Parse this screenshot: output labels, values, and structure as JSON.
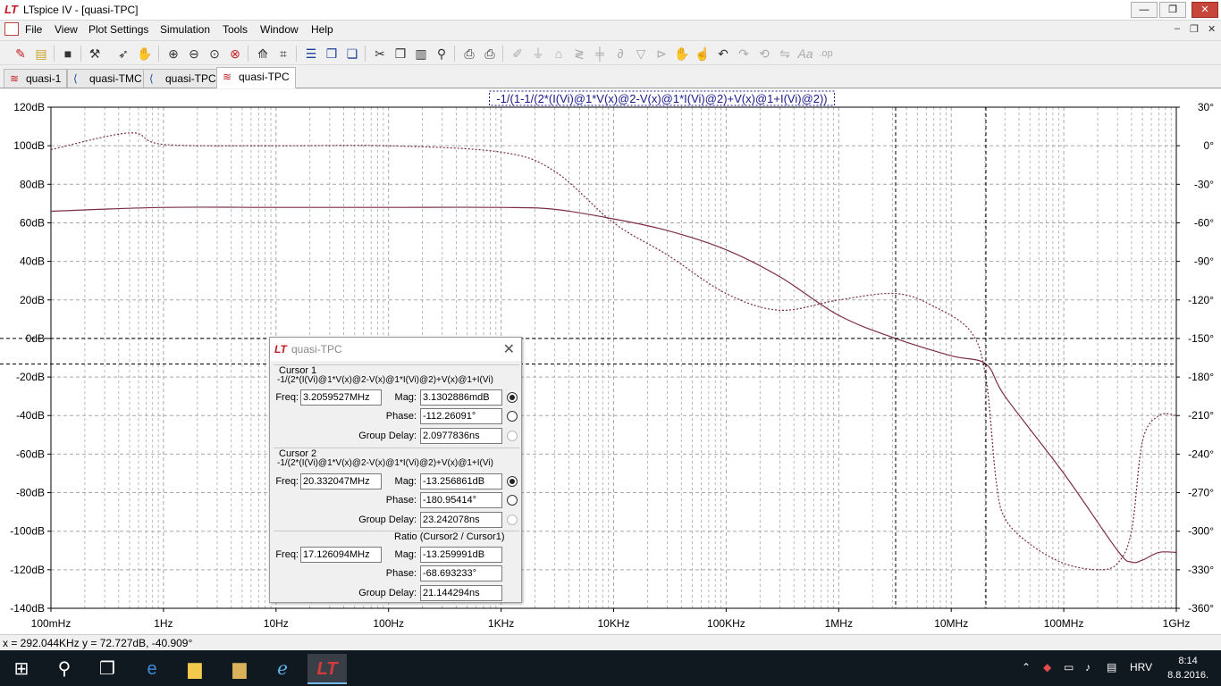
{
  "window": {
    "title": "LTspice IV - [quasi-TPC]",
    "minimize": "—",
    "restore": "❐",
    "close": "✕"
  },
  "menu": {
    "items": [
      "File",
      "View",
      "Plot Settings",
      "Simulation",
      "Tools",
      "Window",
      "Help"
    ],
    "mdi": [
      "–",
      "❐",
      "✕"
    ]
  },
  "toolbar": {
    "icons": [
      "new-schematic-icon",
      "open-icon",
      "save-icon",
      "control-panel-icon",
      "run-icon",
      "halt-icon",
      "zoom-in-icon",
      "zoom-out-icon",
      "zoom-full-icon",
      "zoom-cancel-icon",
      "autorange-icon",
      "grid-icon",
      "tile-horizontal-icon",
      "cascade-icon",
      "tile-vertical-icon",
      "cut-icon",
      "copy-icon",
      "paste-icon",
      "find-icon",
      "print-setup-icon",
      "print-icon",
      "wire-icon",
      "ground-icon",
      "label-icon",
      "resistor-icon",
      "capacitor-icon",
      "inductor-icon",
      "diode-icon",
      "component-icon",
      "move-icon",
      "drag-icon",
      "undo-icon",
      "redo-icon",
      "rotate-icon",
      "mirror-icon",
      "text-icon",
      "spice-directive-icon"
    ]
  },
  "tabs": [
    {
      "label": "quasi-1",
      "icon": "waveform-icon"
    },
    {
      "label": "quasi-TMC",
      "icon": "schematic-icon"
    },
    {
      "label": "quasi-TPC",
      "icon": "schematic-icon"
    },
    {
      "label": "quasi-TPC",
      "icon": "waveform-icon",
      "active": true
    }
  ],
  "plot": {
    "trace_label": "-1/(1-1/(2*(I(Vi)@1*V(x)@2-V(x)@1*I(Vi)@2)+V(x)@1+I(Vi)@2))",
    "trace_color": "#7b2c4a",
    "grid_color": "#a8a8a8",
    "cursor_color": "#000000"
  },
  "chart_data": {
    "type": "line",
    "title": "-1/(1-1/(2*(I(Vi)@1*V(x)@2-V(x)@1*I(Vi)@2)+V(x)@1+I(Vi)@2))",
    "xscale": "log",
    "xlim": [
      0.1,
      1000000000
    ],
    "x_tick_labels": [
      "100mHz",
      "1Hz",
      "10Hz",
      "100Hz",
      "1KHz",
      "10KHz",
      "100KHz",
      "1MHz",
      "10MHz",
      "100MHz",
      "1GHz"
    ],
    "x_tick_values": [
      0.1,
      1,
      10,
      100,
      1000,
      10000,
      100000,
      1000000,
      10000000,
      100000000,
      1000000000
    ],
    "ylim_left": [
      -140,
      120
    ],
    "y_left_ticks": [
      "120dB",
      "100dB",
      "80dB",
      "60dB",
      "40dB",
      "20dB",
      "0dB",
      "-20dB",
      "-40dB",
      "-60dB",
      "-80dB",
      "-100dB",
      "-120dB",
      "-140dB"
    ],
    "y_left_values": [
      120,
      100,
      80,
      60,
      40,
      20,
      0,
      -20,
      -40,
      -60,
      -80,
      -100,
      -120,
      -140
    ],
    "ylim_right": [
      -360,
      30
    ],
    "y_right_ticks": [
      "30°",
      "0°",
      "-30°",
      "-60°",
      "-90°",
      "-120°",
      "-150°",
      "-180°",
      "-210°",
      "-240°",
      "-270°",
      "-300°",
      "-330°",
      "-360°"
    ],
    "y_right_values": [
      30,
      0,
      -30,
      -60,
      -90,
      -120,
      -150,
      -180,
      -210,
      -240,
      -270,
      -300,
      -330,
      -360
    ],
    "grid": true,
    "series": [
      {
        "kind": "magnitude",
        "axis": "left",
        "style": "solid",
        "x": [
          0.1,
          1,
          10,
          100,
          1000,
          3000,
          10000,
          30000,
          100000,
          300000,
          1000000,
          3205953,
          10000000,
          20332047,
          30000000,
          100000000,
          300000000,
          400000000,
          500000000,
          700000000,
          1000000000
        ],
        "y": [
          66,
          68,
          68,
          68,
          68,
          67,
          62,
          56,
          46,
          32,
          12,
          0.003,
          -9,
          -13.26,
          -30,
          -70,
          -110,
          -116,
          -115,
          -111,
          -111
        ]
      },
      {
        "kind": "phase",
        "axis": "right",
        "style": "dashed",
        "x": [
          0.1,
          0.5,
          1,
          10,
          100,
          1000,
          3000,
          10000,
          30000,
          100000,
          300000,
          1000000,
          3205953,
          7000000,
          15000000,
          20332047,
          25000000,
          30000000,
          50000000,
          100000000,
          200000000,
          300000000,
          400000000,
          500000000,
          700000000,
          1000000000
        ],
        "y": [
          -3,
          10,
          1,
          0,
          0,
          -5,
          -20,
          -60,
          -85,
          -115,
          -128,
          -120,
          -115,
          -125,
          -145,
          -180.95,
          -260,
          -290,
          -310,
          -325,
          -330,
          -325,
          -300,
          -230,
          -210,
          -210
        ]
      }
    ],
    "cursors": [
      {
        "name": "Cursor 1",
        "freq_hz": 3205952.7,
        "mag_db": 0.0031302886,
        "phase_deg": -112.26091
      },
      {
        "name": "Cursor 2",
        "freq_hz": 20332047,
        "mag_db": -13.256861,
        "phase_deg": -180.95414
      }
    ]
  },
  "status": {
    "readout": "x = 292.044KHz   y = 72.727dB, -40.909°"
  },
  "cursor_dialog": {
    "title": "quasi-TPC",
    "close": "✕",
    "cursor1": {
      "label": "Cursor 1",
      "expr": "-1/(2*(I(Vi)@1*V(x)@2-V(x)@1*I(Vi)@2)+V(x)@1+I(Vi)",
      "freq_label": "Freq:",
      "freq": "3.2059527MHz",
      "mag_label": "Mag:",
      "mag": "3.1302886mdB",
      "phase_label": "Phase:",
      "phase": "-112.26091°",
      "gd_label": "Group Delay:",
      "gd": "2.0977836ns"
    },
    "cursor2": {
      "label": "Cursor 2",
      "expr": "-1/(2*(I(Vi)@1*V(x)@2-V(x)@1*I(Vi)@2)+V(x)@1+I(Vi)",
      "freq_label": "Freq:",
      "freq": "20.332047MHz",
      "mag_label": "Mag:",
      "mag": "-13.256861dB",
      "phase_label": "Phase:",
      "phase": "-180.95414°",
      "gd_label": "Group Delay:",
      "gd": "23.242078ns"
    },
    "ratio": {
      "label": "Ratio (Cursor2 / Cursor1)",
      "freq_label": "Freq:",
      "freq": "17.126094MHz",
      "mag_label": "Mag:",
      "mag": "-13.259991dB",
      "phase_label": "Phase:",
      "phase": "-68.693233°",
      "gd_label": "Group Delay:",
      "gd": "21.144294ns"
    }
  },
  "taskbar": {
    "apps": [
      "start-icon",
      "search-icon",
      "task-view-icon",
      "edge-icon",
      "file-explorer-icon",
      "folder-icon",
      "internet-explorer-icon",
      "ltspice-icon"
    ],
    "tray_lang": "HRV",
    "time": "8:14",
    "date": "8.8.2016."
  }
}
